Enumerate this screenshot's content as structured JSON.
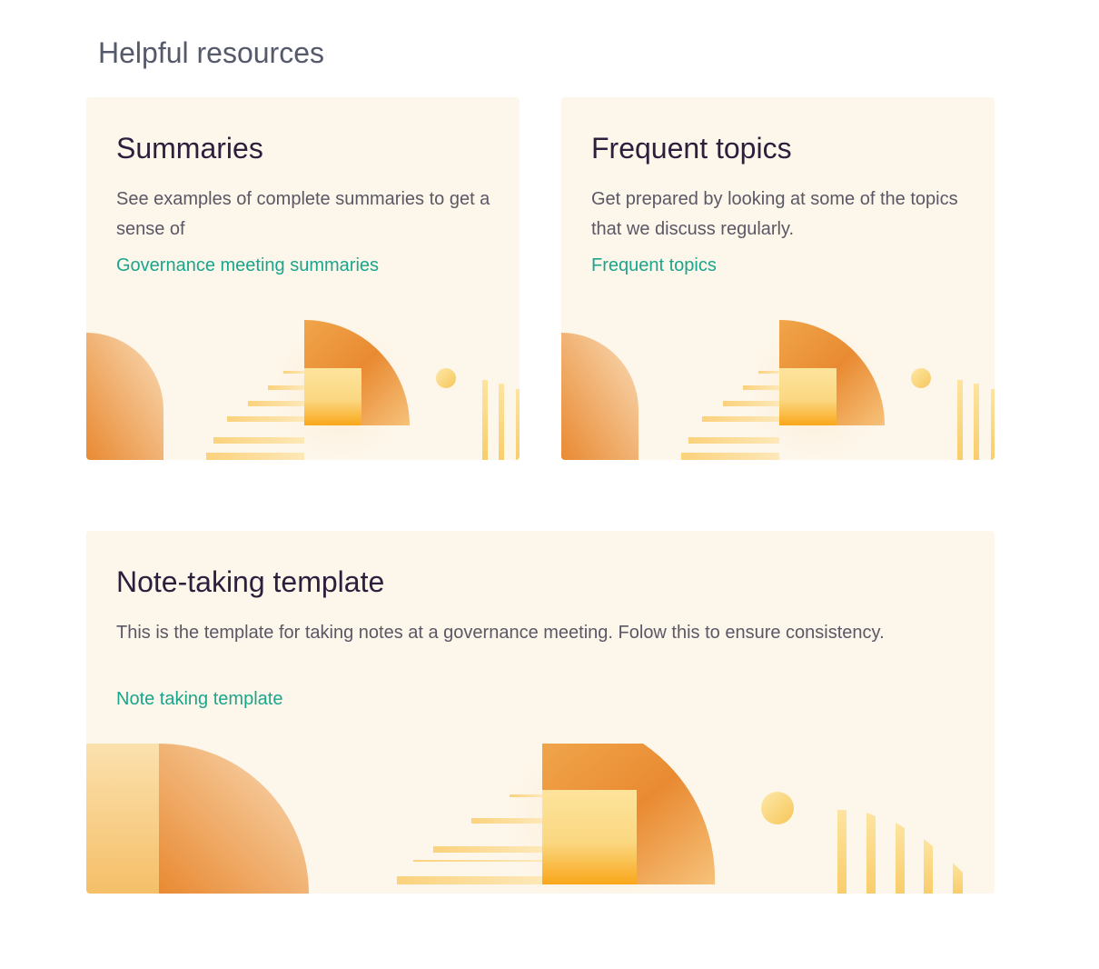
{
  "page": {
    "title": "Helpful resources"
  },
  "cards": [
    {
      "title": "Summaries",
      "description": "See examples of complete summaries to get a sense of",
      "link": "Governance meeting summaries"
    },
    {
      "title": "Frequent topics",
      "description": "Get prepared by looking at some of the topics that we discuss regularly.",
      "link": "Frequent topics"
    },
    {
      "title": "Note-taking template",
      "description": "This is the template for taking notes at a governance meeting. Folow this to ensure consistency.",
      "link": "Note taking template"
    }
  ],
  "colors": {
    "card_background": "#fdf6ea",
    "link": "#1aa58c",
    "title": "#2a1f3d",
    "orange_deep": "#e98a32",
    "orange_light": "#fbd98a"
  }
}
